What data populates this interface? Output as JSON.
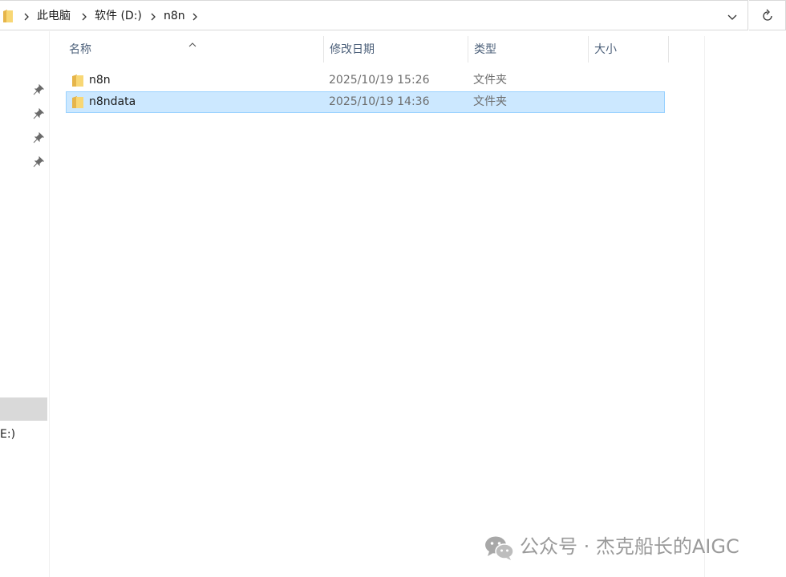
{
  "address_bar": {
    "breadcrumbs": [
      "此电脑",
      "软件 (D:)",
      "n8n"
    ],
    "icon": "folder-icon",
    "dropdown_icon": "chevron-down-icon",
    "refresh_icon": "refresh-icon"
  },
  "columns": {
    "name": "名称",
    "date_modified": "修改日期",
    "type": "类型",
    "size": "大小",
    "sort_indicator": "chevron-up-icon"
  },
  "files": [
    {
      "name": "n8n",
      "date_modified": "2025/10/19 15:26",
      "type": "文件夹",
      "size": "",
      "selected": false,
      "icon": "folder-icon"
    },
    {
      "name": "n8ndata",
      "date_modified": "2025/10/19 14:36",
      "type": "文件夹",
      "size": "",
      "selected": true,
      "icon": "folder-icon"
    }
  ],
  "nav_pane": {
    "pinned_icons": [
      "pin-icon",
      "pin-icon",
      "pin-icon",
      "pin-icon"
    ],
    "drive_label_fragment": "E:)"
  },
  "watermark": {
    "text": "公众号 · 杰克船长的AIGC",
    "icon": "wechat-icon"
  },
  "colors": {
    "selection_fill": "#cce8ff",
    "selection_border": "#99d1ff",
    "header_text": "#4c607a",
    "folder_yellow": "#f8d775"
  }
}
